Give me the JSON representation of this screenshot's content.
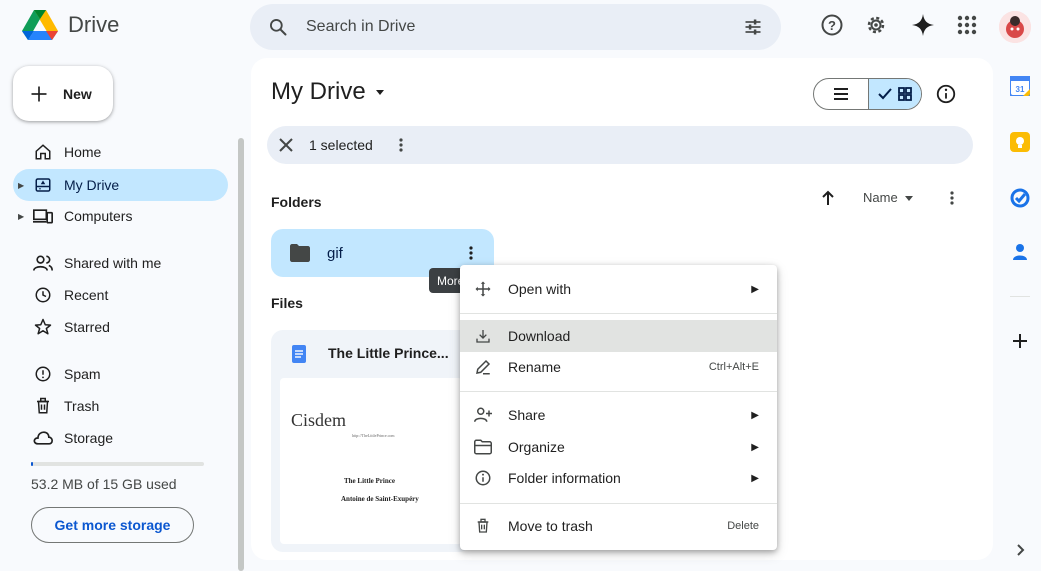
{
  "app": {
    "name": "Drive"
  },
  "search": {
    "placeholder": "Search in Drive"
  },
  "top_icons": [
    "help-icon",
    "settings-icon",
    "gemini-icon",
    "apps-icon"
  ],
  "sidebar": {
    "new_label": "New",
    "items": [
      {
        "label": "Home",
        "icon": "home-icon"
      },
      {
        "label": "My Drive",
        "icon": "my-drive-icon",
        "active": true
      },
      {
        "label": "Computers",
        "icon": "computers-icon"
      },
      {
        "label": "Shared with me",
        "icon": "shared-icon"
      },
      {
        "label": "Recent",
        "icon": "recent-icon"
      },
      {
        "label": "Starred",
        "icon": "star-icon"
      },
      {
        "label": "Spam",
        "icon": "spam-icon"
      },
      {
        "label": "Trash",
        "icon": "trash-icon"
      },
      {
        "label": "Storage",
        "icon": "cloud-icon"
      }
    ],
    "storage_text": "53.2 MB of 15 GB used",
    "storage_fraction": 0.0035,
    "get_storage_label": "Get more storage"
  },
  "main": {
    "title": "My Drive",
    "selection": {
      "text": "1 selected"
    },
    "folders_label": "Folders",
    "files_label": "Files",
    "sort_label": "Name",
    "folders": [
      {
        "name": "gif"
      }
    ],
    "tooltip": "More",
    "files": [
      {
        "name": "The Little Prince...",
        "thumb_title": "Cisdem",
        "thumb_url": "http://TheLittlePrince.com",
        "thumb_line1": "The Little Prince",
        "thumb_line2": "Antoine de Saint-Exupéry"
      }
    ]
  },
  "context_menu": {
    "items": [
      {
        "label": "Open with",
        "icon": "open-with-icon",
        "submenu": true
      },
      {
        "label": "Download",
        "icon": "download-icon",
        "hover": true
      },
      {
        "label": "Rename",
        "icon": "rename-icon",
        "shortcut": "Ctrl+Alt+E"
      },
      {
        "label": "Share",
        "icon": "share-icon",
        "submenu": true
      },
      {
        "label": "Organize",
        "icon": "organize-icon",
        "submenu": true
      },
      {
        "label": "Folder information",
        "icon": "info-icon",
        "submenu": true
      },
      {
        "label": "Move to trash",
        "icon": "trash-icon",
        "shortcut": "Delete"
      }
    ]
  },
  "colors": {
    "accent": "#0b57d0",
    "selected_bg": "#c2e7ff",
    "surface": "#f8fafd",
    "search_bg": "#e9eef6"
  }
}
